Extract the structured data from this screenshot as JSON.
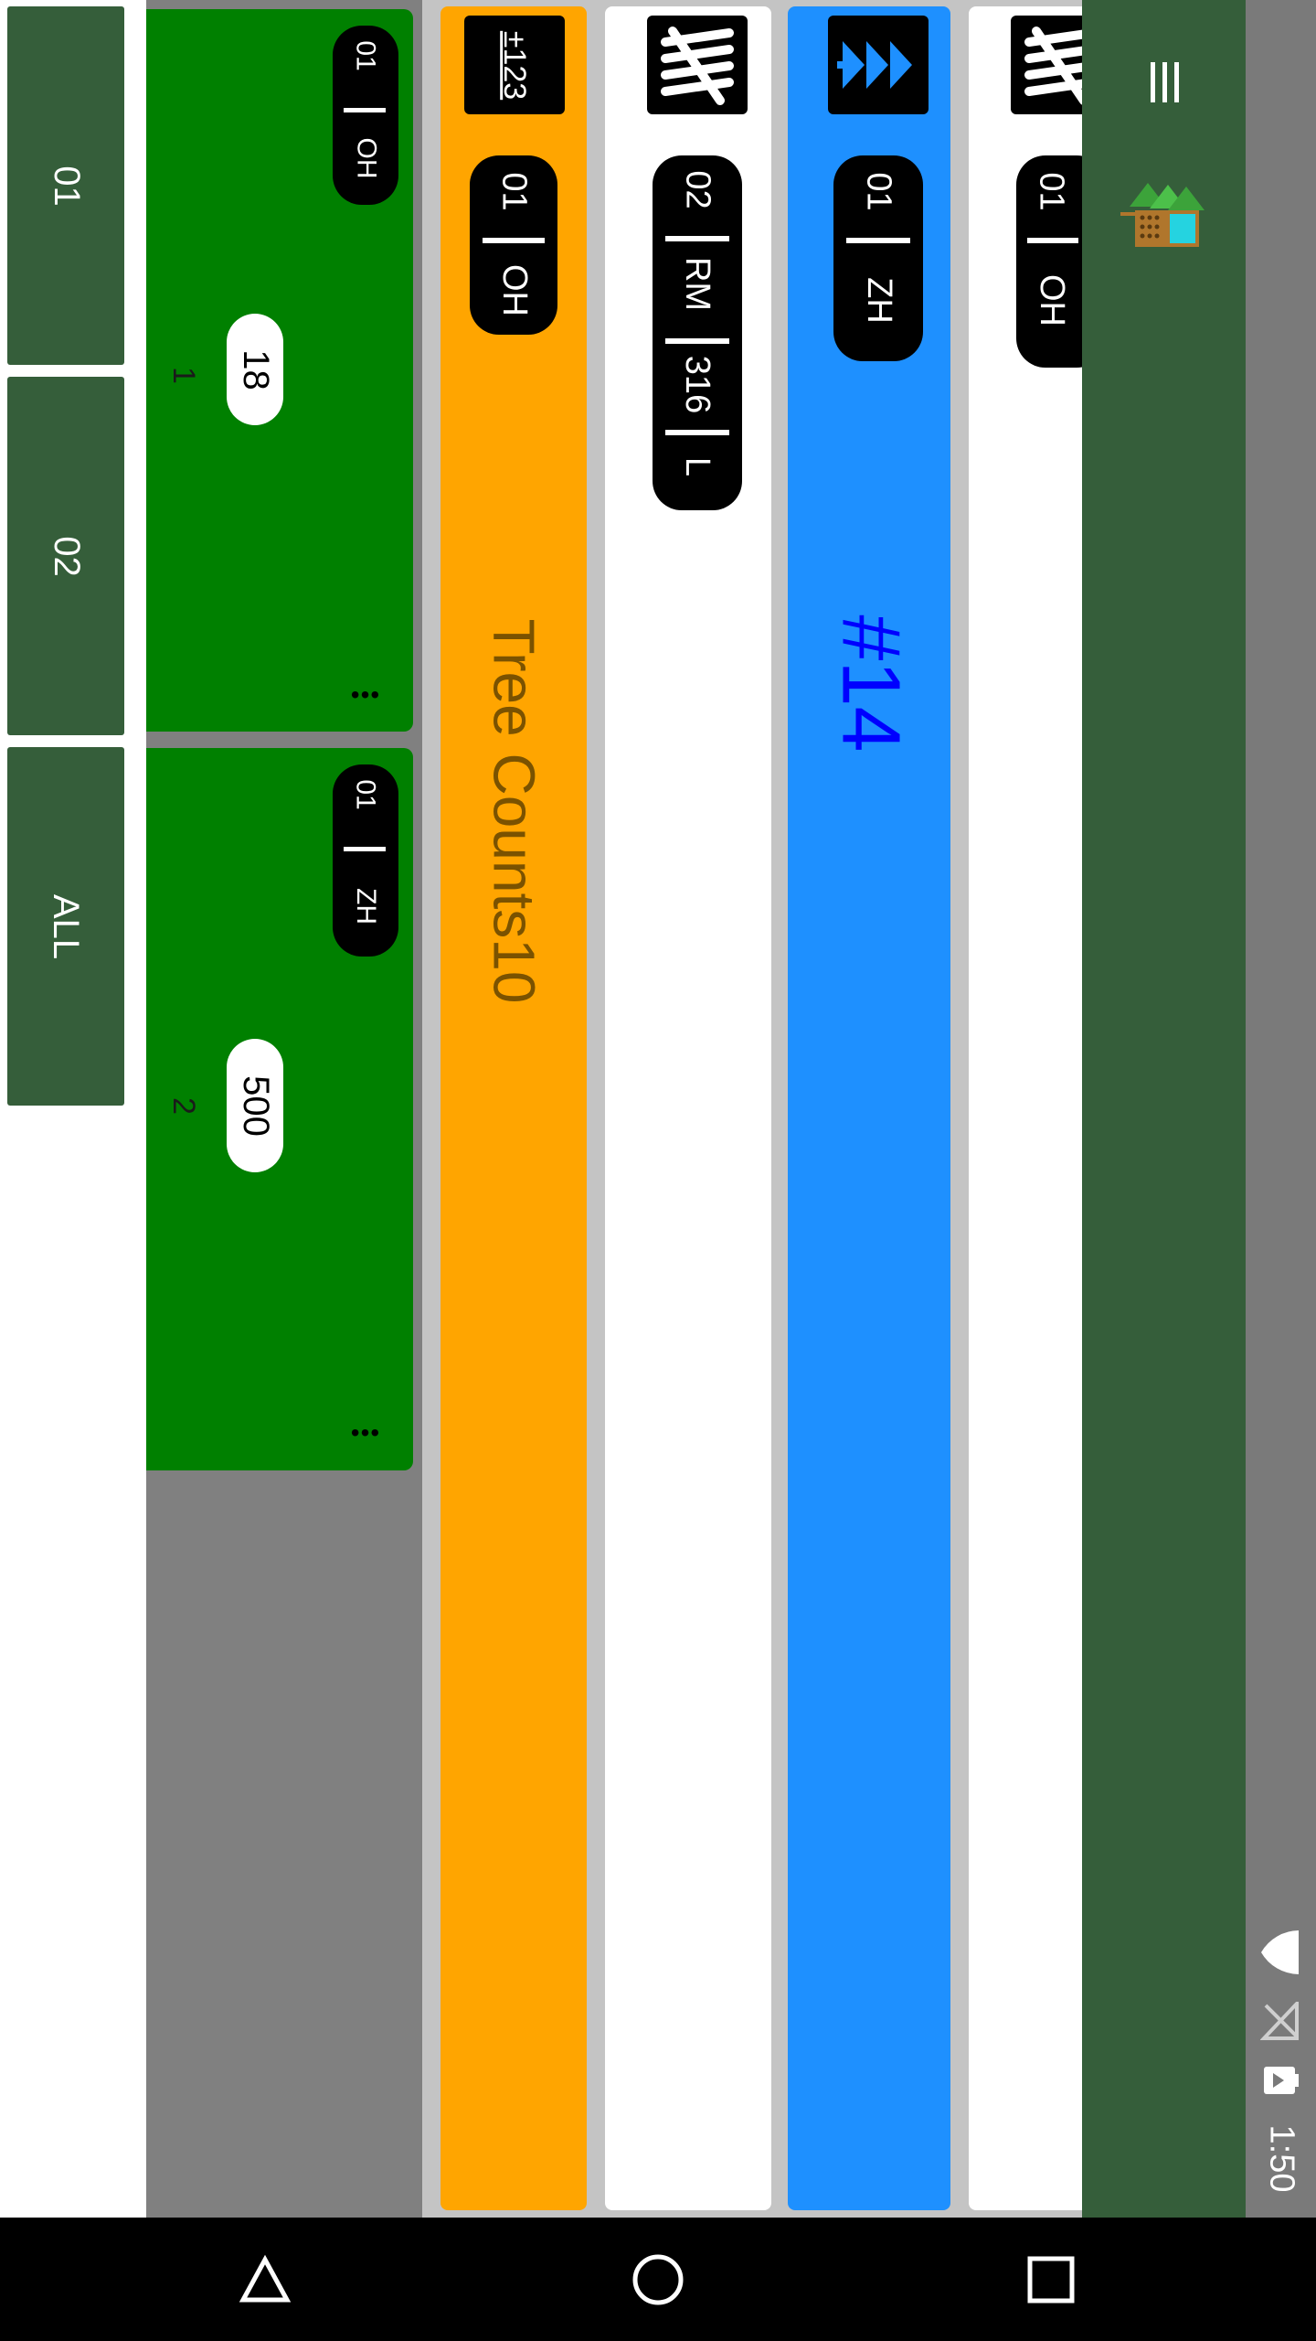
{
  "status": {
    "time": "1:50"
  },
  "filters": [
    {
      "label": "01"
    },
    {
      "label": "02"
    },
    {
      "label": "ALL"
    }
  ],
  "cards": [
    {
      "code": "01",
      "spp": "OH",
      "count": "18",
      "index": "1",
      "more": "•••"
    },
    {
      "code": "01",
      "spp": "ZH",
      "count": "500",
      "index": "2",
      "more": "•••"
    }
  ],
  "rows": [
    {
      "color": "#FFA500",
      "badge": "±123",
      "tag": [
        "01",
        "OH"
      ],
      "title": "Tree Counts10",
      "title_color": "#7a5200"
    },
    {
      "color": "#FFFFFF",
      "badge_icon": "tally-icon",
      "tag": [
        "02",
        "RM",
        "316",
        "L"
      ]
    },
    {
      "color": "#1E90FF",
      "badge_icon": "tree-icon",
      "tag": [
        "01",
        "ZH"
      ],
      "title": "#14",
      "title_color": "#0000ff"
    },
    {
      "color": "#FFFFFF",
      "badge_icon": "tally-icon",
      "tag": [
        "01",
        "OH"
      ]
    }
  ],
  "colors": {
    "app_bar": "#355E3A",
    "card": "#008000",
    "accent": "#FFA500",
    "blue": "#1E90FF"
  }
}
